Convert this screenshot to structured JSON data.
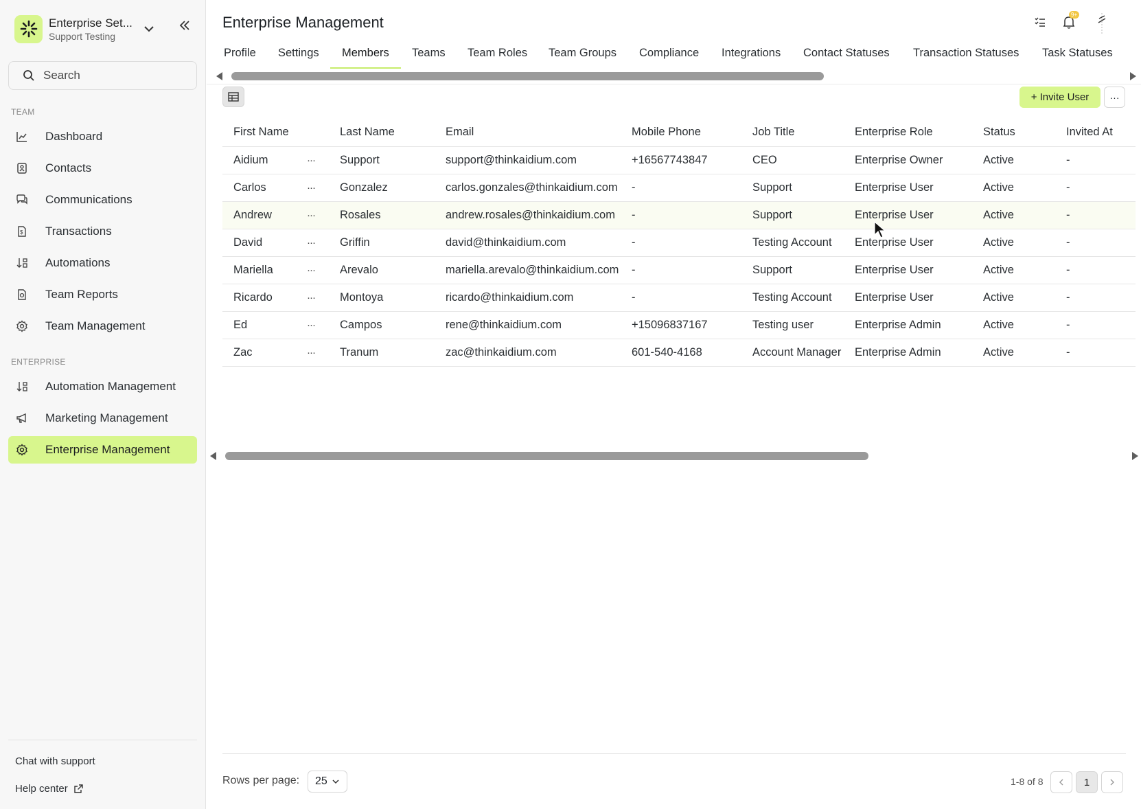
{
  "workspace": {
    "name": "Enterprise Set...",
    "subtitle": "Support Testing"
  },
  "search": {
    "placeholder": "Search"
  },
  "sidebar": {
    "team_label": "TEAM",
    "enterprise_label": "ENTERPRISE",
    "team_items": [
      {
        "label": "Dashboard",
        "icon": "chart-line-icon"
      },
      {
        "label": "Contacts",
        "icon": "contacts-icon"
      },
      {
        "label": "Communications",
        "icon": "chat-bubbles-icon"
      },
      {
        "label": "Transactions",
        "icon": "document-dollar-icon"
      },
      {
        "label": "Automations",
        "icon": "automation-icon"
      },
      {
        "label": "Team Reports",
        "icon": "report-icon"
      },
      {
        "label": "Team Management",
        "icon": "gear-icon"
      }
    ],
    "enterprise_items": [
      {
        "label": "Automation Management",
        "icon": "automation-icon"
      },
      {
        "label": "Marketing Management",
        "icon": "megaphone-icon"
      },
      {
        "label": "Enterprise Management",
        "icon": "gear-icon",
        "active": true
      }
    ],
    "footer": {
      "chat": "Chat with support",
      "help": "Help center"
    }
  },
  "header": {
    "title": "Enterprise Management",
    "notification_badge": "9+"
  },
  "tabs": [
    {
      "label": "Profile"
    },
    {
      "label": "Settings"
    },
    {
      "label": "Members",
      "active": true
    },
    {
      "label": "Teams"
    },
    {
      "label": "Team Roles"
    },
    {
      "label": "Team Groups"
    },
    {
      "label": "Compliance"
    },
    {
      "label": "Integrations"
    },
    {
      "label": "Contact Statuses"
    },
    {
      "label": "Transaction Statuses"
    },
    {
      "label": "Task Statuses"
    }
  ],
  "toolbar": {
    "invite_label": "+ Invite User",
    "more_label": "···"
  },
  "table": {
    "columns": [
      "First Name",
      "Last Name",
      "Email",
      "Mobile Phone",
      "Job Title",
      "Enterprise Role",
      "Status",
      "Invited At"
    ],
    "rows": [
      [
        "Aidium",
        "Support",
        "support@thinkaidium.com",
        "+16567743847",
        "CEO",
        "Enterprise Owner",
        "Active",
        "-"
      ],
      [
        "Carlos",
        "Gonzalez",
        "carlos.gonzales@thinkaidium.com",
        "-",
        "Support",
        "Enterprise User",
        "Active",
        "-"
      ],
      [
        "Andrew",
        "Rosales",
        "andrew.rosales@thinkaidium.com",
        "-",
        "Support",
        "Enterprise User",
        "Active",
        "-"
      ],
      [
        "David",
        "Griffin",
        "david@thinkaidium.com",
        "-",
        "Testing Account",
        "Enterprise User",
        "Active",
        "-"
      ],
      [
        "Mariella",
        "Arevalo",
        "mariella.arevalo@thinkaidium.com",
        "-",
        "Support",
        "Enterprise User",
        "Active",
        "-"
      ],
      [
        "Ricardo",
        "Montoya",
        "ricardo@thinkaidium.com",
        "-",
        "Testing Account",
        "Enterprise User",
        "Active",
        "-"
      ],
      [
        "Ed",
        "Campos",
        "rene@thinkaidium.com",
        "+15096837167",
        "Testing user",
        "Enterprise Admin",
        "Active",
        "-"
      ],
      [
        "Zac",
        "Tranum",
        "zac@thinkaidium.com",
        "601-540-4168",
        "Account Manager",
        "Enterprise Admin",
        "Active",
        "-"
      ]
    ],
    "row_menu": "···"
  },
  "pagination": {
    "rows_label": "Rows per page:",
    "rows_value": "25",
    "range": "1-8 of 8",
    "page": "1"
  },
  "colors": {
    "accent": "#d8f68d",
    "sidebar_bg": "#f7f7f7"
  }
}
